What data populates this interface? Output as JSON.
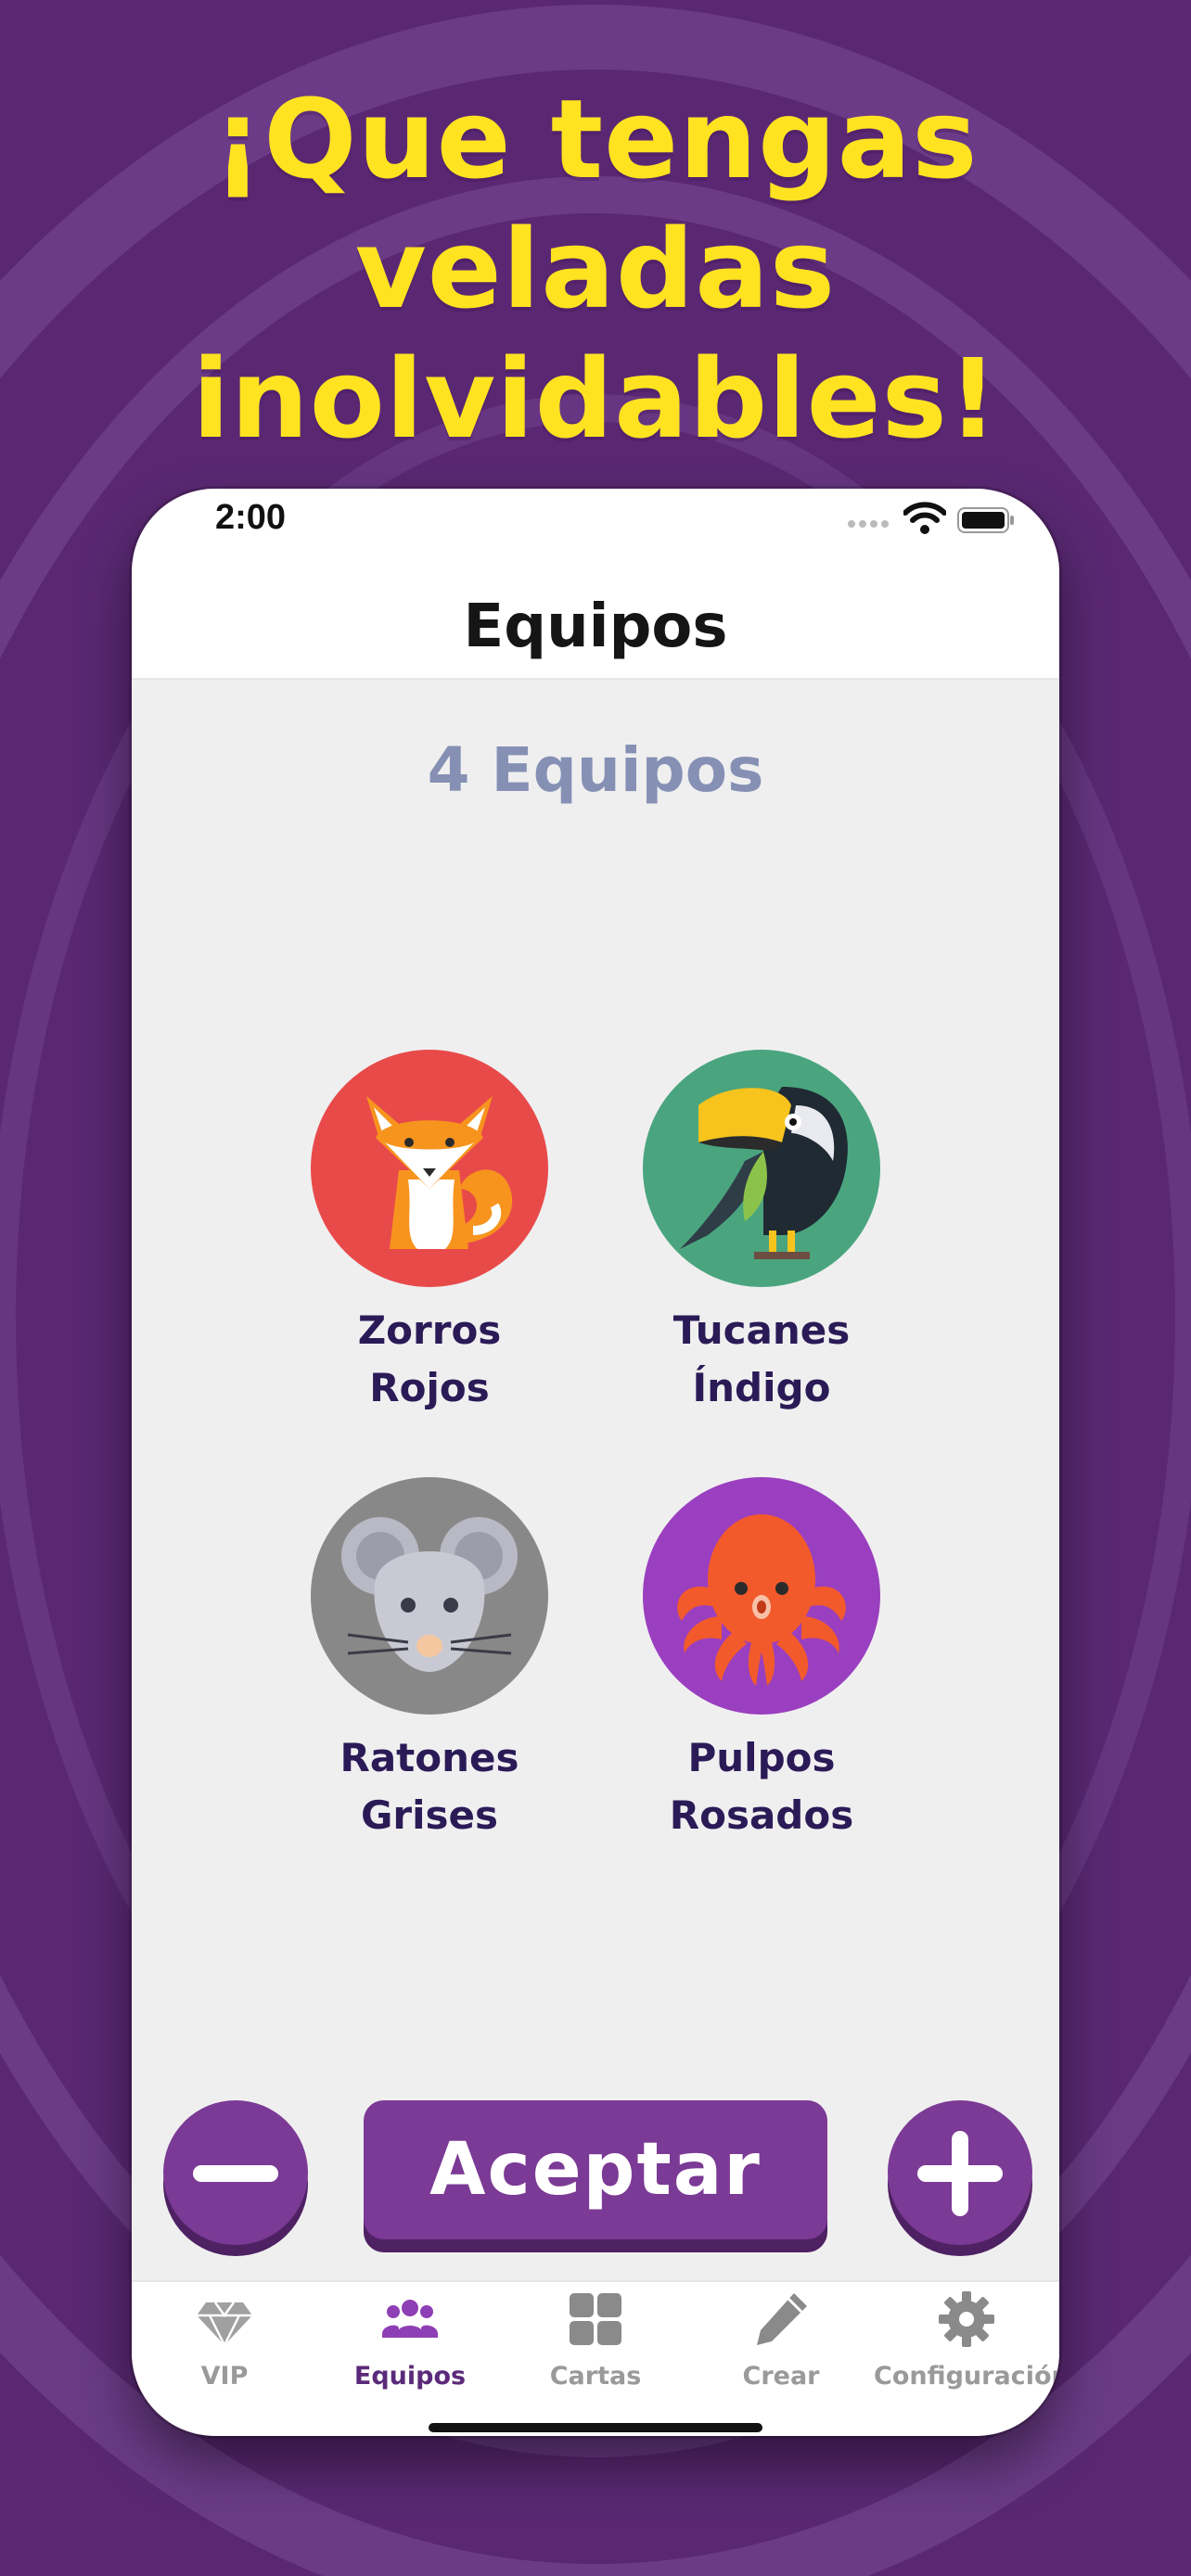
{
  "headline": {
    "line1": "¡Que tengas veladas",
    "line2": "inolvidables!"
  },
  "status_bar": {
    "time": "2:00"
  },
  "nav": {
    "title": "Equipos"
  },
  "teams_count": "4 Equipos",
  "teams": [
    {
      "line1": "Zorros",
      "line2": "Rojos",
      "color": "#e84a4a",
      "icon": "fox-icon"
    },
    {
      "line1": "Tucanes",
      "line2": "Índigo",
      "color": "#4aa57f",
      "icon": "toucan-icon"
    },
    {
      "line1": "Ratones",
      "line2": "Grises",
      "color": "#888888",
      "icon": "mouse-icon"
    },
    {
      "line1": "Pulpos",
      "line2": "Rosados",
      "color": "#9a3fbf",
      "icon": "octopus-icon"
    }
  ],
  "actions": {
    "accept_label": "Aceptar"
  },
  "tabs": [
    {
      "label": "VIP",
      "icon": "diamond-icon"
    },
    {
      "label": "Equipos",
      "icon": "people-icon",
      "active": true
    },
    {
      "label": "Cartas",
      "icon": "grid-icon"
    },
    {
      "label": "Crear",
      "icon": "pencil-icon"
    },
    {
      "label": "Configuración",
      "icon": "gear-icon"
    }
  ],
  "colors": {
    "background": "#5b2a74",
    "headline": "#ffe321",
    "accent": "#7b3a95",
    "team_name": "#2a1b57",
    "count": "#8590b4"
  }
}
